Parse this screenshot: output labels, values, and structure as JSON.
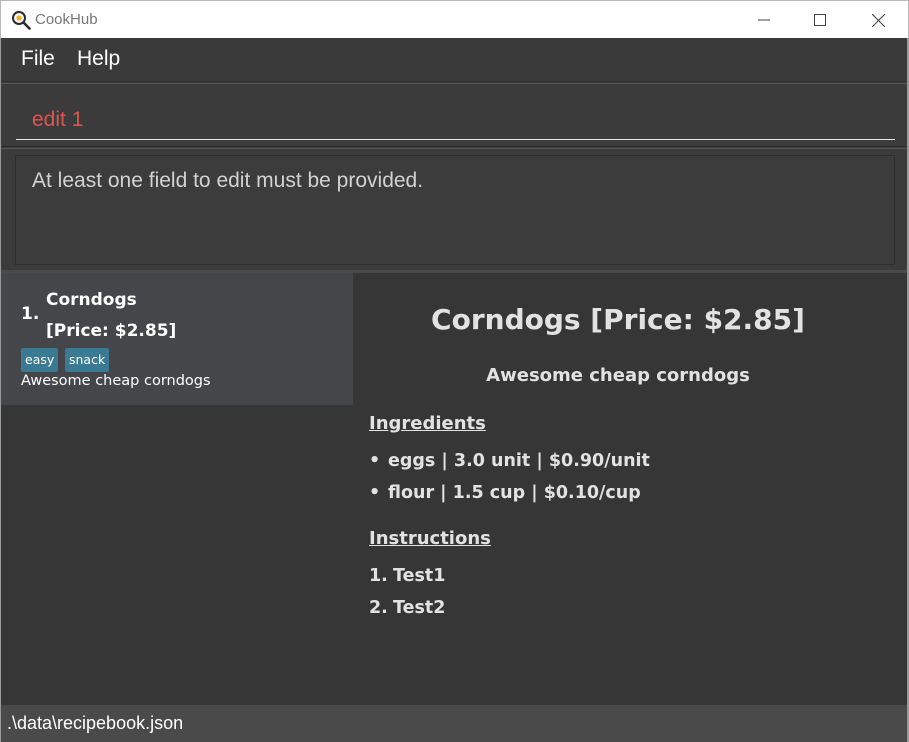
{
  "window": {
    "title": "CookHub"
  },
  "menu": {
    "file": "File",
    "help": "Help"
  },
  "command": {
    "value": "edit 1"
  },
  "result": {
    "message": "At least one field to edit must be provided."
  },
  "recipe_list": [
    {
      "index": "1.",
      "name": "Corndogs",
      "price": "[Price: $2.85]",
      "tags": [
        "easy",
        "snack"
      ],
      "description": "Awesome cheap corndogs"
    }
  ],
  "detail": {
    "title": "Corndogs [Price: $2.85]",
    "description": "Awesome cheap corndogs",
    "ingredients_heading": "Ingredients",
    "ingredients": [
      {
        "bullet": "•",
        "text": "eggs | 3.0 unit | $0.90/unit"
      },
      {
        "bullet": "•",
        "text": "flour | 1.5 cup | $0.10/cup"
      }
    ],
    "instructions_heading": "Instructions",
    "instructions": [
      {
        "num": "1.",
        "text": "Test1"
      },
      {
        "num": "2.",
        "text": "Test2"
      }
    ]
  },
  "status": {
    "path": ".\\data\\recipebook.json"
  },
  "colors": {
    "command_text": "#d9574f",
    "tag_bg": "#3b7a93",
    "background": "#3d3d3d",
    "selected_card": "#444649"
  },
  "icons": {
    "app": "frying-pan-egg-icon",
    "minimize": "minimize-icon",
    "maximize": "maximize-icon",
    "close": "close-icon"
  }
}
